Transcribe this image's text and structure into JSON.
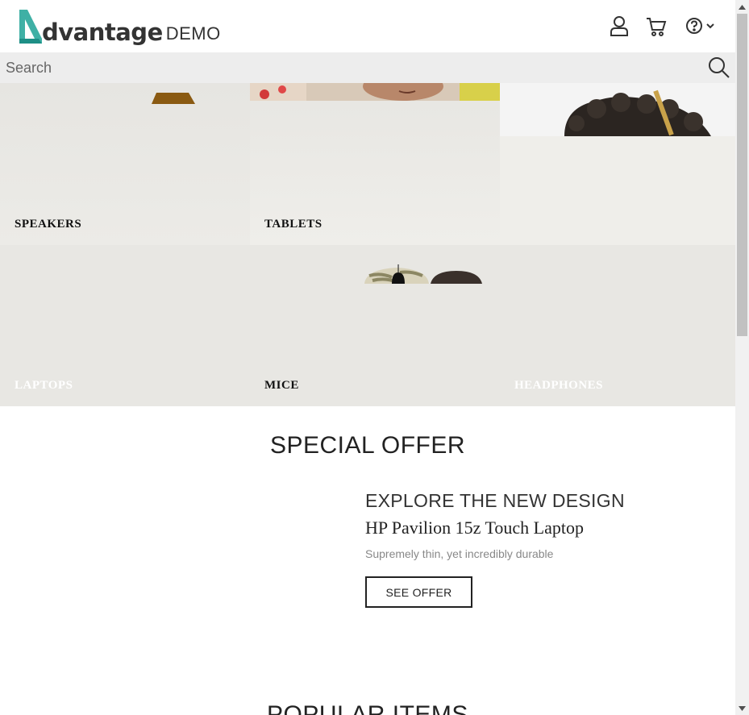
{
  "header": {
    "logo_text": "dvantage",
    "logo_demo": "DEMO",
    "icons": [
      "user-icon",
      "cart-icon",
      "help-icon",
      "chevron-down-icon"
    ]
  },
  "search": {
    "placeholder": "Search"
  },
  "categories": [
    {
      "label": "SPEAKERS"
    },
    {
      "label": "TABLETS"
    },
    {
      "label": "LAPTOPS"
    },
    {
      "label": "MICE"
    },
    {
      "label": "HEADPHONES"
    }
  ],
  "special_offer": {
    "title": "SPECIAL OFFER",
    "tagline": "EXPLORE THE NEW DESIGN",
    "product_name": "HP Pavilion 15z Touch Laptop",
    "description": "Supremely thin, yet incredibly durable",
    "button_label": "SEE OFFER"
  },
  "popular": {
    "title": "POPULAR ITEMS"
  },
  "colors": {
    "brand_teal": "#3fb0a5",
    "search_bg": "#ededed",
    "category_bg": "#e9e8e4"
  }
}
